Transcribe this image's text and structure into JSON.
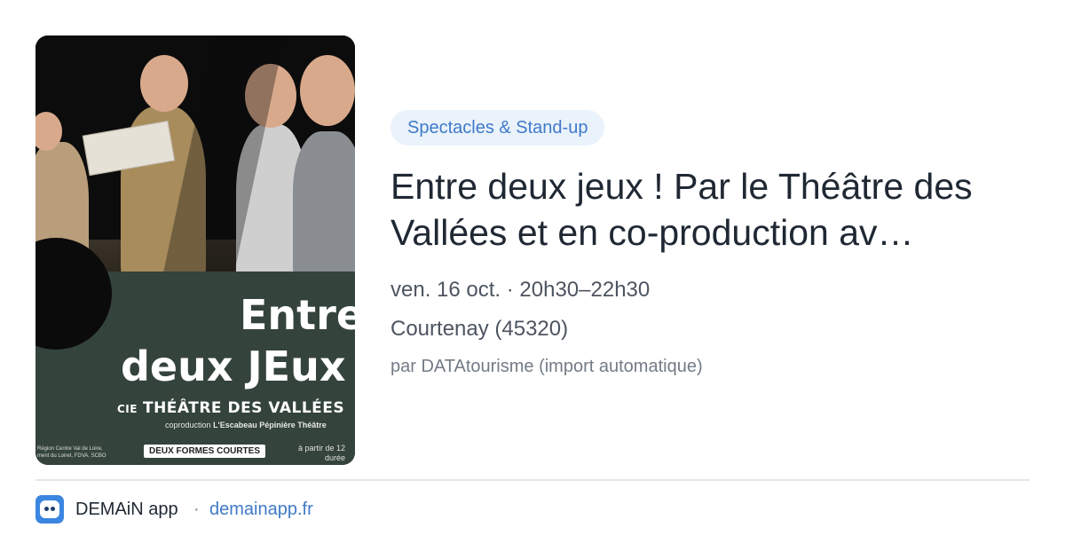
{
  "event": {
    "category": "Spectacles & Stand-up",
    "title": "Entre deux jeux ! Par le Théâtre des Vallées et en co-production av…",
    "date": "ven. 16 oct. · 20h30–22h30",
    "location": "Courtenay (45320)",
    "source": "par DATAtourisme (import automatique)"
  },
  "poster": {
    "title_line1": "Entre",
    "title_line2": "deux JEux",
    "company_prefix": "CIE",
    "company": "THÉÂTRE DES VALLÉES",
    "coproduction_prefix": "coproduction",
    "coproduction": "L'Escabeau Pépinière Théâtre",
    "funders_line1": "Région Centre Val de Loire,",
    "funders_line2": "ment du Loiret, FDVA, SCBO",
    "badge": "DEUX FORMES COURTES",
    "age_line1": "à partir de 12",
    "age_line2": "durée"
  },
  "footer": {
    "app_name": "DEMAiN app",
    "separator": "·",
    "domain": "demainapp.fr"
  },
  "colors": {
    "accent": "#3f7ac8",
    "chip_bg": "#eaf2fb",
    "poster_green": "#34433b"
  }
}
